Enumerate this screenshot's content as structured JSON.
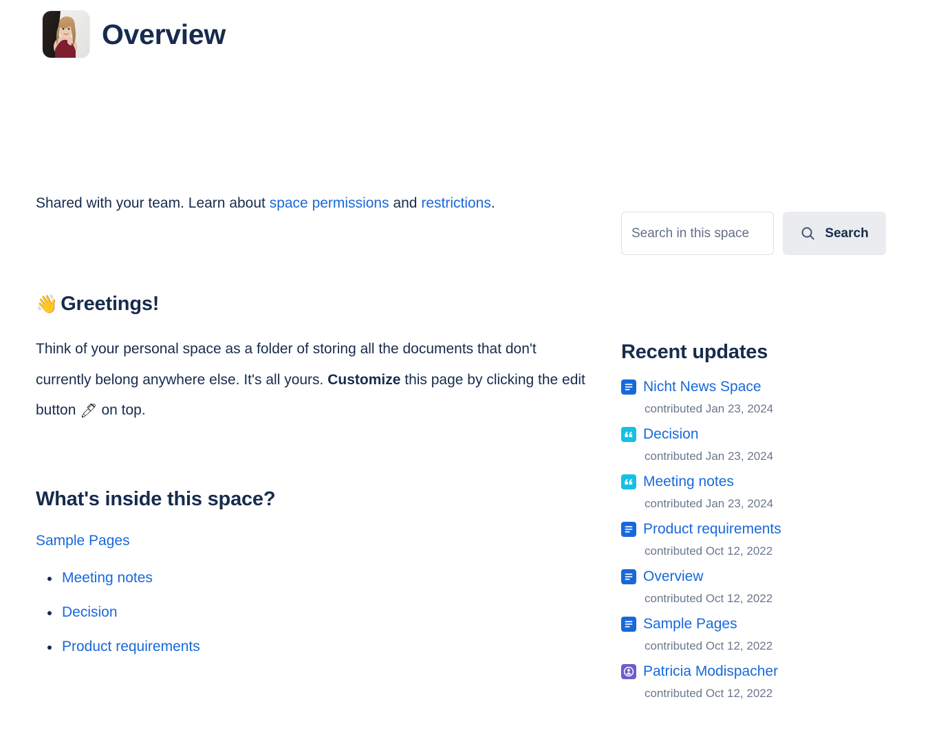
{
  "header": {
    "title": "Overview",
    "avatar_alt": "space-avatar-photo"
  },
  "main": {
    "intro": {
      "text_before": "Shared with your team. Learn about ",
      "link_permissions": "space permissions",
      "text_middle": " and ",
      "link_restrictions": "restrictions",
      "text_after": "."
    },
    "greeting": {
      "emoji": "👋",
      "heading": "Greetings!",
      "body_part1": "Think of your personal space as a folder of storing all the documents that don't currently belong anywhere else. It's all yours. ",
      "body_bold": "Customize",
      "body_part2": " this page by clicking the edit button ",
      "pencil_emoji": "🖊",
      "body_part3": " on top."
    },
    "inside": {
      "heading": "What's inside this space?",
      "parent_link": "Sample Pages",
      "items": [
        {
          "label": "Meeting notes"
        },
        {
          "label": "Decision"
        },
        {
          "label": "Product requirements"
        }
      ]
    }
  },
  "search": {
    "placeholder": "Search in this space",
    "value": "",
    "button_label": "Search",
    "icon": "search-icon"
  },
  "recent_updates": {
    "heading": "Recent updates",
    "items": [
      {
        "title": "Nicht News Space",
        "meta": "contributed Jan 23, 2024",
        "icon": "page-icon",
        "kind": "page"
      },
      {
        "title": "Decision",
        "meta": "contributed Jan 23, 2024",
        "icon": "blog-quote-icon",
        "kind": "blog"
      },
      {
        "title": "Meeting notes",
        "meta": "contributed Jan 23, 2024",
        "icon": "blog-quote-icon",
        "kind": "blog"
      },
      {
        "title": "Product requirements",
        "meta": "contributed Oct 12, 2022",
        "icon": "page-icon",
        "kind": "page"
      },
      {
        "title": "Overview",
        "meta": "contributed Oct 12, 2022",
        "icon": "page-icon",
        "kind": "page"
      },
      {
        "title": "Sample Pages",
        "meta": "contributed Oct 12, 2022",
        "icon": "page-icon",
        "kind": "page"
      },
      {
        "title": "Patricia Modispacher",
        "meta": "contributed Oct 12, 2022",
        "icon": "person-icon",
        "kind": "user"
      }
    ]
  },
  "colors": {
    "link": "#1868DB",
    "text": "#172B4D",
    "meta": "#6B778C",
    "page_icon_bg": "#1868DB",
    "blog_icon_bg": "#16C0E5",
    "user_icon_bg": "#6E5DC6",
    "button_bg": "#EBECF0"
  }
}
